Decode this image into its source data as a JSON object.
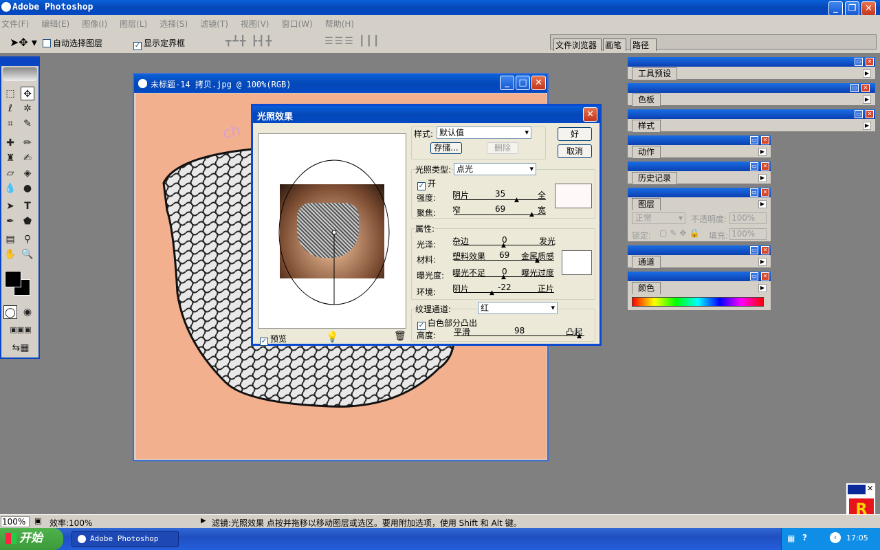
{
  "app": {
    "title": "Adobe Photoshop"
  },
  "menu": [
    "文件(F)",
    "编辑(E)",
    "图像(I)",
    "图层(L)",
    "选择(S)",
    "滤镜(T)",
    "视图(V)",
    "窗口(W)",
    "帮助(H)"
  ],
  "options": {
    "auto_select_label": "自动选择图层",
    "auto_select_checked": false,
    "show_bounds_label": "显示定界框",
    "show_bounds_checked": true
  },
  "palette_well": {
    "tabs": [
      "文件浏览器",
      "画笔",
      "路径"
    ]
  },
  "panels": {
    "tool_presets": "工具预设",
    "swatches": "色板",
    "styles": "样式",
    "actions": "动作",
    "history": "历史记录",
    "layers": {
      "tab": "图层",
      "blend_mode": "正常",
      "opacity_label": "不透明度:",
      "opacity": "100%",
      "lock_label": "锁定:",
      "fill_label": "填充:",
      "fill": "100%"
    },
    "channels": "通道",
    "color": "颜色"
  },
  "document": {
    "title": "未标题-14 拷贝.jpg @ 100%(RGB)",
    "watermark": "ch"
  },
  "dialog": {
    "title": "光照效果",
    "style_label": "样式:",
    "style_value": "默认值",
    "save_btn": "存储...",
    "delete_btn": "删除",
    "ok_btn": "好",
    "cancel_btn": "取消",
    "light_type_label": "光照类型:",
    "light_type_value": "点光",
    "on_label": "开",
    "on_checked": true,
    "intensity": {
      "label": "强度:",
      "left": "阴片",
      "value": "35",
      "right": "全"
    },
    "focus": {
      "label": "聚焦:",
      "left": "窄",
      "value": "69",
      "right": "宽"
    },
    "properties_label": "属性:",
    "gloss": {
      "label": "光泽:",
      "left": "杂边",
      "value": "0",
      "right": "发光"
    },
    "material": {
      "label": "材料:",
      "left": "塑料效果",
      "value": "69",
      "right": "金属质感"
    },
    "exposure": {
      "label": "曝光度:",
      "left": "曝光不足",
      "value": "0",
      "right": "曝光过度"
    },
    "ambience": {
      "label": "环境:",
      "left": "阴片",
      "value": "-22",
      "right": "正片"
    },
    "texture_label": "纹理通道:",
    "texture_value": "红",
    "white_high_label": "白色部分凸出",
    "white_high_checked": true,
    "height": {
      "label": "高度:",
      "left": "平滑",
      "value": "98",
      "right": "凸起"
    },
    "preview_label": "预览",
    "preview_checked": true
  },
  "status": {
    "zoom": "100%",
    "efficiency": "效率:100%",
    "message": "滤镜:光照效果  点按并拖移以移动图层或选区。要用附加选项，使用 Shift 和 Alt 键。"
  },
  "taskbar": {
    "start": "开始",
    "task": "Adobe Photoshop",
    "clock": "17:05"
  },
  "colors": {
    "canvas_bg": "#f2b08e",
    "title_blue": "#0a5fd8",
    "start_green": "#3c9a3a"
  }
}
